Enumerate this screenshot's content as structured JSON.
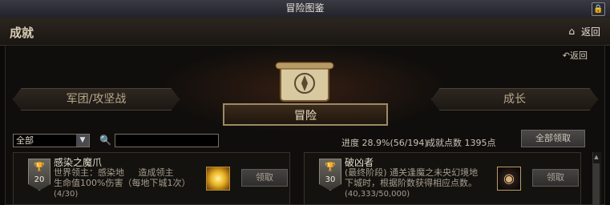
{
  "window": {
    "title": "冒险图鉴"
  },
  "header": {
    "section": "成就",
    "home_icon": "home-icon",
    "back_label": "返回"
  },
  "panel": {
    "back_label": "返回"
  },
  "tabs": {
    "left": "军团/攻坚战",
    "active": "冒险",
    "right": "成长"
  },
  "filter": {
    "selected": "全部",
    "search_placeholder": ""
  },
  "stats": {
    "progress": "进度 28.9%(56/194)",
    "points": "成就点数 1395点"
  },
  "buttons": {
    "claim_all": "全部领取"
  },
  "cards": [
    {
      "title": "感染之魔爪",
      "points": "20",
      "desc": "世界领主：感染地     造成领主\n生命值100%伤害（每地下城1次）",
      "progress": "(4/30)",
      "reward_icon": "gold-burst-icon",
      "claim": "领取"
    },
    {
      "title": "破凶者",
      "points": "30",
      "desc": "(最终阶段) 通关逢魔之未央幻境地\n下城时，根据阶数获得相应点数。",
      "progress": "(40,333/50,000)",
      "reward_icon": "emblem-icon",
      "claim": "领取"
    }
  ],
  "colors": {
    "accent_gold": "#9c8a66",
    "background": "#0b0a09"
  }
}
